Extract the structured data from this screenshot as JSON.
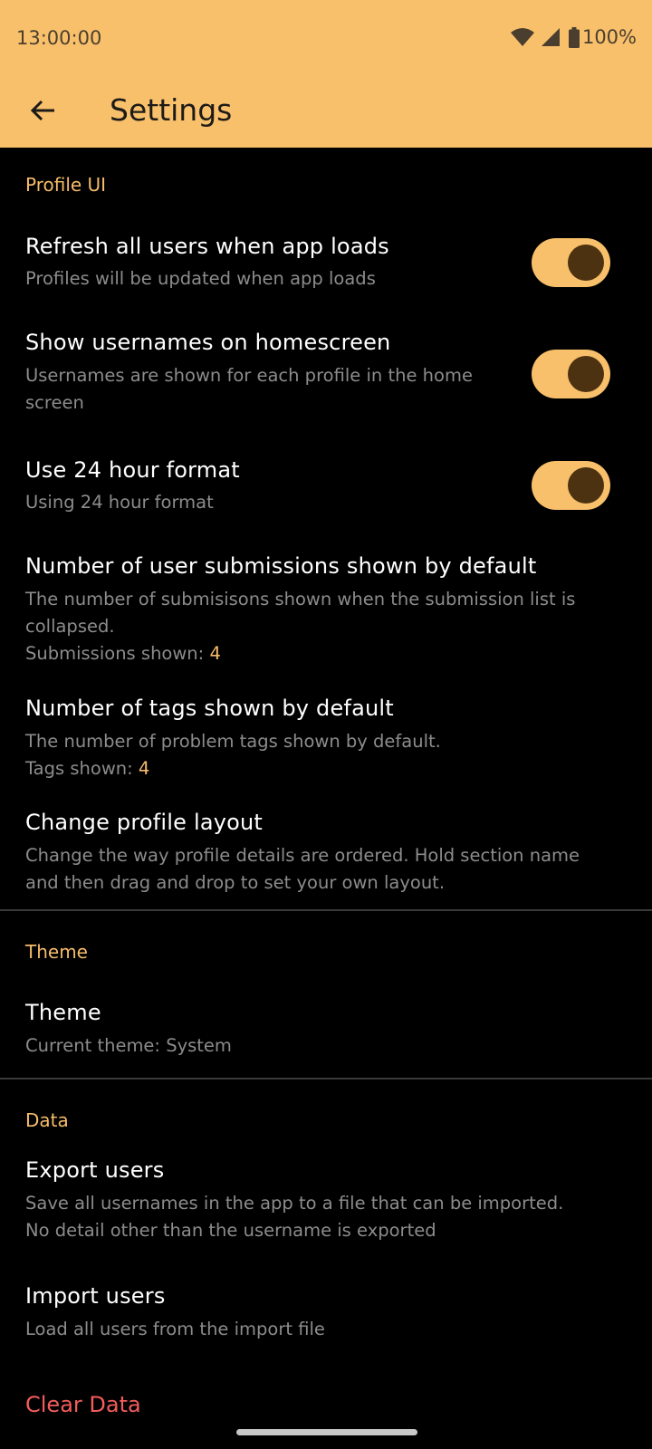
{
  "status_bar": {
    "time": "13:00:00",
    "battery": "100%"
  },
  "app_bar": {
    "title": "Settings"
  },
  "sections": {
    "profile_ui": {
      "header": "Profile UI",
      "refresh": {
        "title": "Refresh all users when app loads",
        "subtitle": "Profiles will be updated when app loads",
        "enabled": true
      },
      "usernames": {
        "title": "Show usernames on homescreen",
        "subtitle_line1": "Usernames are shown for each profile in the home",
        "subtitle_line2": "screen",
        "enabled": true
      },
      "hour24": {
        "title": "Use 24 hour format",
        "subtitle": "Using 24 hour format",
        "enabled": true
      },
      "submissions": {
        "title": "Number of user submissions shown by default",
        "subtitle_line1": "The number of submisisons shown when the submission list is",
        "subtitle_line2": "collapsed.",
        "count_label": "Submissions shown: ",
        "count_value": "4"
      },
      "tags": {
        "title": "Number of tags shown by default",
        "subtitle": "The number of problem tags shown by default.",
        "count_label": "Tags shown: ",
        "count_value": "4"
      },
      "layout": {
        "title": "Change profile layout",
        "subtitle_line1": "Change the way profile details are ordered. Hold section name",
        "subtitle_line2": "and then drag and drop to set your own layout."
      }
    },
    "theme": {
      "header": "Theme",
      "item": {
        "title": "Theme",
        "subtitle": "Current theme: System"
      }
    },
    "data": {
      "header": "Data",
      "export": {
        "title": "Export users",
        "subtitle_line1": "Save all usernames in the app to a file that can be imported.",
        "subtitle_line2": "No detail other than the username is exported"
      },
      "import": {
        "title": "Import users",
        "subtitle": "Load all users from the import file"
      },
      "clear": {
        "title": "Clear Data"
      }
    }
  },
  "colors": {
    "app_bar_bg": "#f9c06b",
    "accent": "#f6bc6a",
    "background": "#000000",
    "danger": "#f25c5c",
    "switch_knob": "#4d3211"
  },
  "icons": {
    "back": "arrow-left-icon",
    "wifi": "wifi-icon",
    "signal": "cell-signal-icon",
    "battery": "battery-icon"
  }
}
